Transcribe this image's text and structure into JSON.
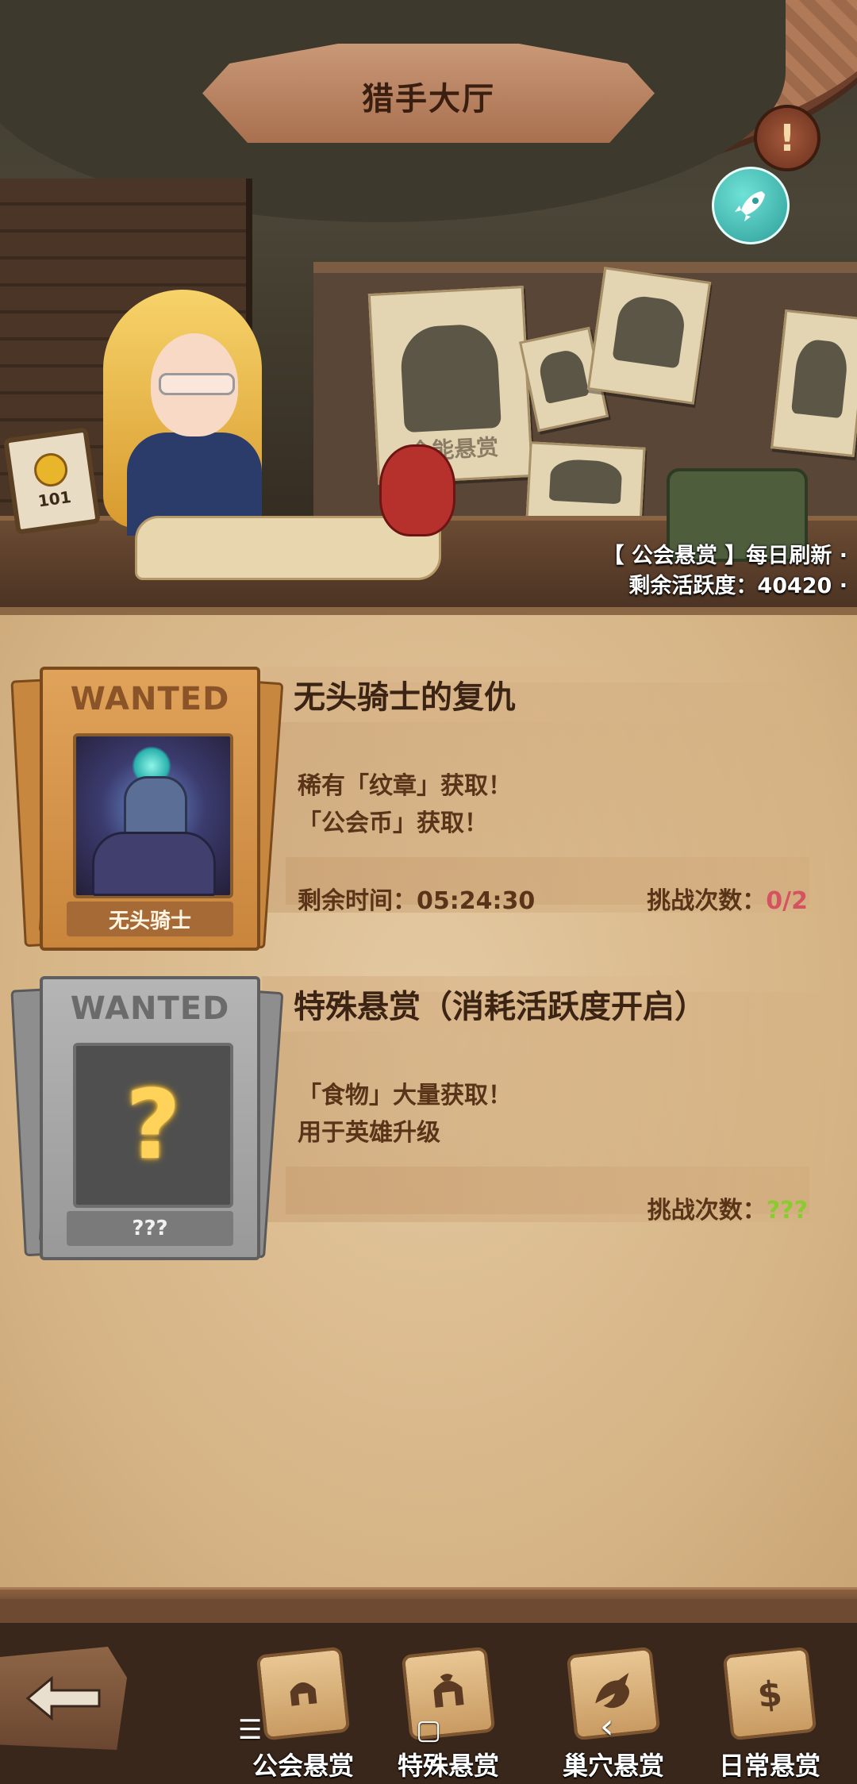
{
  "header": {
    "title": "猎手大厅"
  },
  "scene": {
    "coin_sign_value": "101",
    "poster_text": "全能悬赏",
    "guild_bounty_info": "【 公会悬赏 】每日刷新 ·",
    "activity_remaining": "剩余活跃度：40420 ·"
  },
  "bounties": [
    {
      "wanted_label": "WANTED",
      "portrait_name": "无头骑士",
      "title": "无头骑士的复仇",
      "reward_lines": [
        "稀有「纹章」获取！",
        "「公会币」获取！"
      ],
      "time_remaining": "剩余时间：05:24:30",
      "challenge_label": "挑战次数：",
      "challenge_value": "0/2",
      "challenge_color": "#d55360"
    },
    {
      "wanted_label": "WANTED",
      "portrait_name": "???",
      "portrait_symbol": "?",
      "title": "特殊悬赏（消耗活跃度开启）",
      "reward_lines": [
        "「食物」大量获取！",
        "用于英雄升级"
      ],
      "challenge_label": "挑战次数：",
      "challenge_value": "???",
      "challenge_color": "#8acc2f"
    }
  ],
  "bottom_tabs": [
    {
      "label": "公会悬赏",
      "icon": "helmet-icon"
    },
    {
      "label": "特殊悬赏",
      "icon": "spartan-helmet-icon"
    },
    {
      "label": "巢穴悬赏",
      "icon": "dragon-icon"
    },
    {
      "label": "日常悬赏",
      "icon": "dollar-icon"
    }
  ],
  "system_nav": {
    "menu": "☰",
    "home": "▢",
    "back": "‹"
  },
  "colors": {
    "accent_gold": "#c9853c",
    "locked_grey": "#999999",
    "rocket_teal": "#2e9e99"
  }
}
